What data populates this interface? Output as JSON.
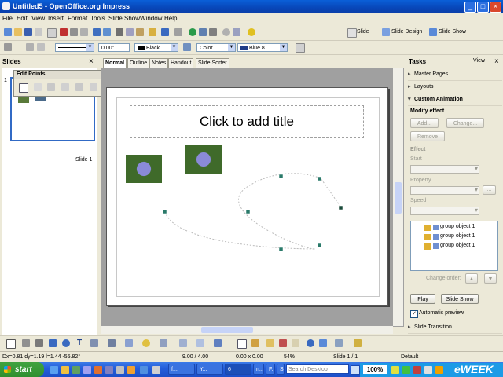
{
  "window": {
    "title": "Untitled5 - OpenOffice.org Impress",
    "min": "_",
    "max": "□",
    "close": "×"
  },
  "menu": [
    "File",
    "Edit",
    "View",
    "Insert",
    "Format",
    "Tools",
    "Slide Show",
    "Window",
    "Help"
  ],
  "toolbar1": {
    "slide": "Slide",
    "slide_design": "Slide Design",
    "slide_show": "Slide Show"
  },
  "toolbar2": {
    "line_width": "0.00\"",
    "line_color": "Black",
    "area_style": "Color",
    "area_color": "Blue 8"
  },
  "colors": {
    "line_color": "#000000",
    "area_color": "#1f3c88",
    "accent": "#0a5fd8",
    "taskbar": "#245edb",
    "selection": "#316ac5"
  },
  "slides_pane": {
    "title": "Slides",
    "close": "×",
    "slide_number": "1",
    "slide_caption": "Slide 1"
  },
  "edit_points": {
    "title": "Edit Points",
    "menu_arrow": "▾",
    "close": "×"
  },
  "tabs": [
    "Normal",
    "Outline",
    "Notes",
    "Handout",
    "Slide Sorter"
  ],
  "active_tab": "Normal",
  "slide": {
    "title_placeholder": "Click to add title"
  },
  "tasks": {
    "title": "Tasks",
    "view": "View",
    "close": "×",
    "sections": {
      "master_pages": "Master Pages",
      "layouts": "Layouts",
      "custom_animation": "Custom Animation",
      "slide_transition": "Slide Transition"
    },
    "modify_effect": "Modify effect",
    "add": "Add...",
    "change": "Change...",
    "remove": "Remove",
    "effect": "Effect",
    "start": "Start",
    "property": "Property",
    "speed": "Speed",
    "more": "...",
    "effects_list": [
      "group object 1",
      "group object 1",
      "group object 1"
    ],
    "change_order": "Change order:",
    "play": "Play",
    "slide_show": "Slide Show",
    "automatic_preview": "Automatic preview",
    "automatic_preview_checked": true
  },
  "status": {
    "delta": "Dx=0.81 dy=1.19 l=1.44 -55.82°",
    "position": "9.00 / 4.00",
    "size": "0.00 x 0.00",
    "zoom": "54%",
    "slide": "Slide 1 / 1",
    "master": "Default"
  },
  "taskbar": {
    "start": "start",
    "items": [
      "f...",
      "Y...",
      "6",
      "n...",
      "F...",
      "S..."
    ],
    "search_placeholder": "Search Desktop",
    "zoom": "100%",
    "watermark": "eWEEK"
  }
}
